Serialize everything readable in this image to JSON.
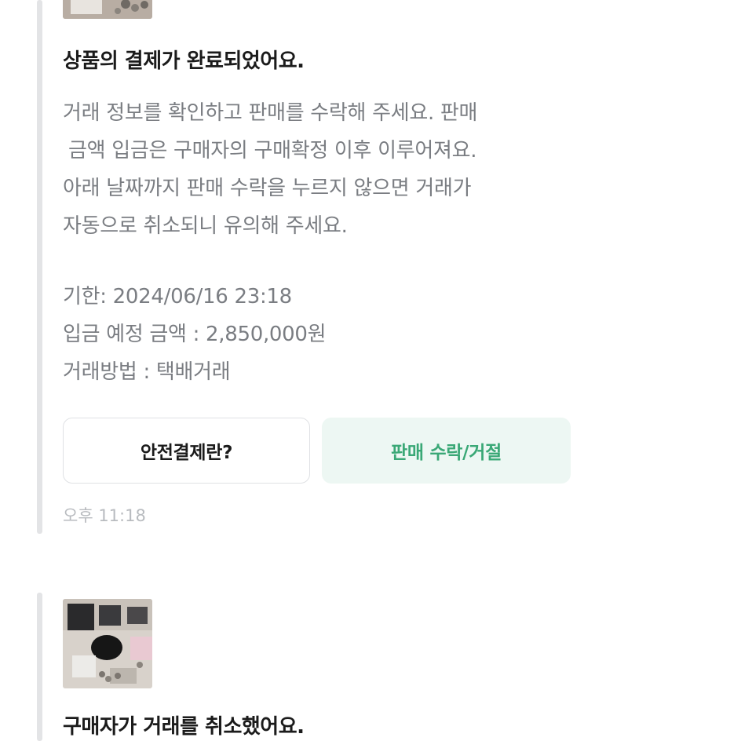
{
  "message_1": {
    "title": "상품의 결제가 완료되었어요.",
    "body_lines": [
      "거래 정보를 확인하고 판매를 수락해 주세요. 판매",
      "금액 입금은 구매자의 구매확정 이후 이루어져요.",
      "아래 날짜까지 판매 수락을 누르지 않으면 거래가",
      "자동으로 취소되니 유의해 주세요."
    ],
    "deadline": "기한: 2024/06/16 23:18",
    "expected_amount": "입금 예정 금액 : 2,850,000원",
    "trade_method": "거래방법 : 택배거래",
    "safe_payment_button": "안전결제란?",
    "accept_reject_button": "판매 수락/거절",
    "time": "오후 11:18"
  },
  "message_2": {
    "title": "구매자가 거래를 취소했어요."
  },
  "colors": {
    "accent_green": "#3aa876",
    "accent_green_bg": "#edf7f3",
    "body_gray": "#7a7d82"
  }
}
